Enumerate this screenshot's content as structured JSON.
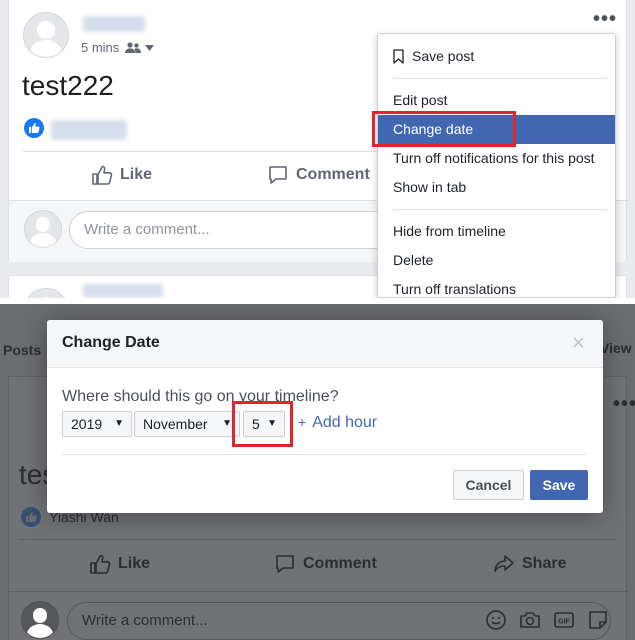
{
  "post": {
    "time": "5 mins",
    "text": "test222",
    "actions": {
      "like": "Like",
      "comment": "Comment"
    },
    "comment_placeholder": "Write a comment...",
    "more_dots": "•••"
  },
  "menu": {
    "items": [
      "Save post",
      "Edit post",
      "Change date",
      "Turn off notifications for this post",
      "Show in tab",
      "Hide from timeline",
      "Delete",
      "Turn off translations"
    ],
    "selected": "Change date"
  },
  "background": {
    "tab_posts": "Posts",
    "tab_view": "View",
    "post_text": "tes",
    "reactor": "Yiashi Wan",
    "actions": {
      "like": "Like",
      "comment": "Comment",
      "share": "Share"
    },
    "comment_placeholder": "Write a comment...",
    "more_dots": "•••"
  },
  "dialog": {
    "title": "Change Date",
    "question": "Where should this go on your timeline?",
    "year": "2019",
    "month": "November",
    "day": "5",
    "add_hour": "Add hour",
    "add_hour_prefix": "+",
    "cancel": "Cancel",
    "save": "Save",
    "close": "×"
  },
  "colors": {
    "facebook_blue": "#4267b2",
    "like_blue": "#1877f2",
    "highlight_red": "#e0262b"
  }
}
